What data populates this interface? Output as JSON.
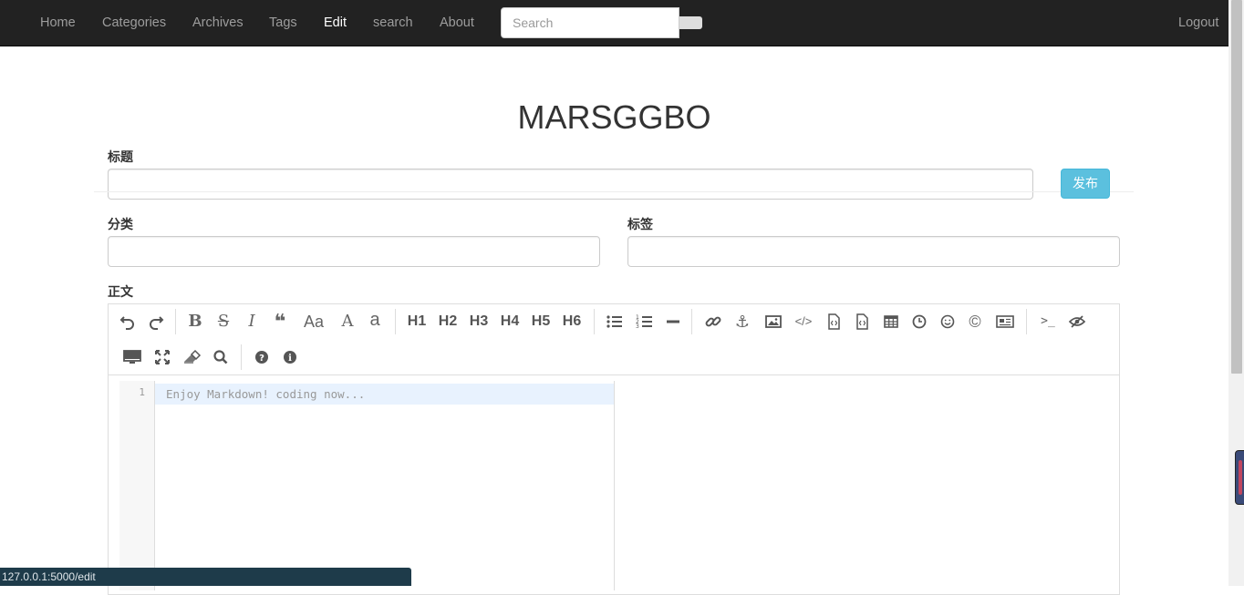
{
  "nav": {
    "items": [
      {
        "label": "Home",
        "active": false
      },
      {
        "label": "Categories",
        "active": false
      },
      {
        "label": "Archives",
        "active": false
      },
      {
        "label": "Tags",
        "active": false
      },
      {
        "label": "Edit",
        "active": true
      },
      {
        "label": "search",
        "active": false
      },
      {
        "label": "About",
        "active": false
      }
    ],
    "search_placeholder": "Search",
    "logout_label": "Logout"
  },
  "page": {
    "site_title": "MARSGGBO"
  },
  "form": {
    "title_label": "标题",
    "title_value": "",
    "publish_label": "发布",
    "category_label": "分类",
    "category_value": "",
    "tags_label": "标签",
    "tags_value": "",
    "body_label": "正文"
  },
  "editor": {
    "toolbar": [
      "undo-icon",
      "redo-icon",
      "bold-icon",
      "strikethrough-icon",
      "italic-icon",
      "quote-icon",
      "uppercase-icon",
      "first-letter-uppercase-icon",
      "lowercase-icon",
      "h1",
      "h2",
      "h3",
      "h4",
      "h5",
      "h6",
      "unordered-list-icon",
      "ordered-list-icon",
      "horizontal-rule-icon",
      "link-icon",
      "anchor-icon",
      "image-icon",
      "inline-code-icon",
      "code-block-icon",
      "preformatted-text-icon",
      "table-icon",
      "datetime-icon",
      "emoji-icon",
      "html-entities-icon",
      "pagebreak-icon",
      "goto-line-icon",
      "watch-toggle-icon",
      "preview-icon",
      "fullscreen-icon",
      "clear-icon",
      "search-icon",
      "help-icon",
      "info-icon"
    ],
    "heading_labels": {
      "h1": "H1",
      "h2": "H2",
      "h3": "H3",
      "h4": "H4",
      "h5": "H5",
      "h6": "H6"
    },
    "case_labels": {
      "upper": "Aa",
      "first": "A",
      "lower": "a"
    },
    "line_number": "1",
    "placeholder": "Enjoy Markdown! coding now...",
    "preview_content": ""
  },
  "status_bar": {
    "url": "127.0.0.1:5000/edit"
  },
  "colors": {
    "navbar_bg": "#222222",
    "nav_active": "#ffffff",
    "nav_text": "#9d9d9d",
    "publish_bg": "#5bc0de",
    "active_line": "#e8f2fe"
  }
}
